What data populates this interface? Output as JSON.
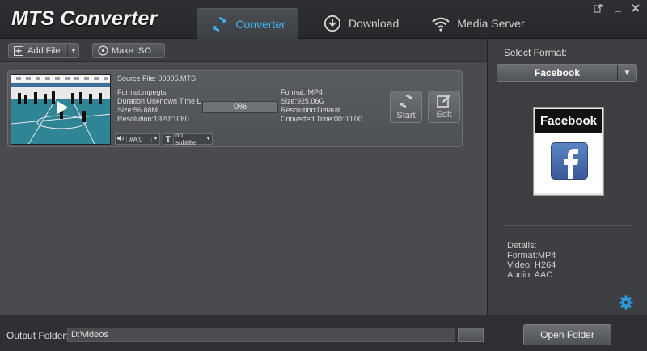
{
  "app": {
    "title": "MTS Converter"
  },
  "tabs": [
    {
      "label": "Converter",
      "icon": "refresh-icon",
      "active": true
    },
    {
      "label": "Download",
      "icon": "download-icon"
    },
    {
      "label": "Media Server",
      "icon": "wifi-icon"
    }
  ],
  "toolbar": {
    "add_file": "Add File",
    "make_iso": "Make ISO"
  },
  "file": {
    "source": "Source File: 00005.MTS",
    "src_format": "Format:mpegts",
    "duration": "Duration:Unknown Time Le",
    "size": "Size:56.88M",
    "resolution": "Resolution:1920*1080",
    "progress": "0%",
    "out_format": "Format: MP4",
    "out_size": "Size:925.06G",
    "out_resolution": "Resolution:Default",
    "converted_time": "Converted Time:00:00:00",
    "start": "Start",
    "edit": "Edit",
    "audio_track": "#A:0",
    "subtitle": "no subtitle"
  },
  "right": {
    "select_format_label": "Select Format:",
    "selected_format": "Facebook",
    "card_caption": "Facebook",
    "details": [
      "Details:",
      "Format:MP4",
      "Video: H264",
      "Audio: AAC"
    ]
  },
  "bottom": {
    "output_label": "Output Folder:",
    "output_path": "D:\\videos",
    "browse": "...",
    "open_folder": "Open Folder"
  },
  "colors": {
    "accent": "#40b5f0",
    "facebook": "#3b5998"
  }
}
